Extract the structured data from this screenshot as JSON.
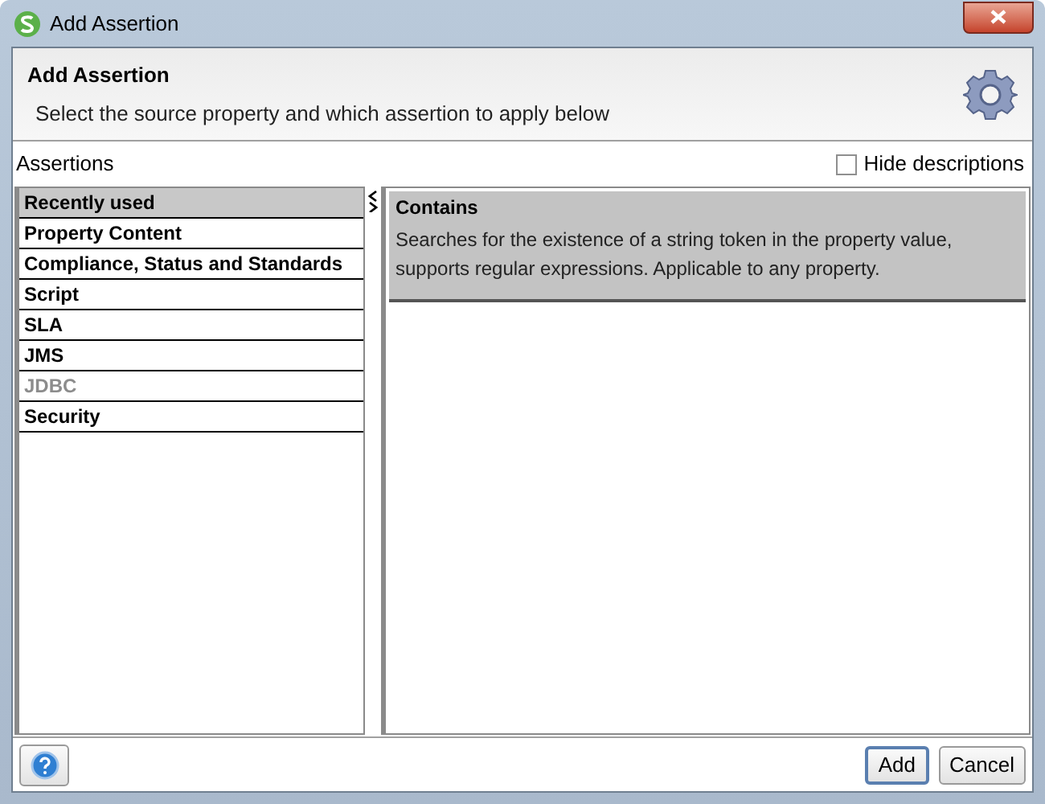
{
  "window": {
    "title": "Add Assertion"
  },
  "header": {
    "title": "Add Assertion",
    "subtitle": "Select the source property and which assertion to apply below"
  },
  "assertions_label": "Assertions",
  "hide_descriptions": {
    "label": "Hide descriptions",
    "checked": false
  },
  "categories": [
    {
      "label": "Recently used",
      "selected": true,
      "disabled": false
    },
    {
      "label": "Property Content",
      "selected": false,
      "disabled": false
    },
    {
      "label": "Compliance, Status and Standards",
      "selected": false,
      "disabled": false
    },
    {
      "label": "Script",
      "selected": false,
      "disabled": false
    },
    {
      "label": "SLA",
      "selected": false,
      "disabled": false
    },
    {
      "label": "JMS",
      "selected": false,
      "disabled": false
    },
    {
      "label": "JDBC",
      "selected": false,
      "disabled": true
    },
    {
      "label": "Security",
      "selected": false,
      "disabled": false
    }
  ],
  "assertions": [
    {
      "name": "Contains",
      "description": "Searches for the existence of a string token in the property value, supports regular expressions. Applicable to any property.",
      "selected": true
    }
  ],
  "buttons": [
    {
      "label": "Add",
      "default": true
    },
    {
      "label": "Cancel",
      "default": false
    }
  ]
}
